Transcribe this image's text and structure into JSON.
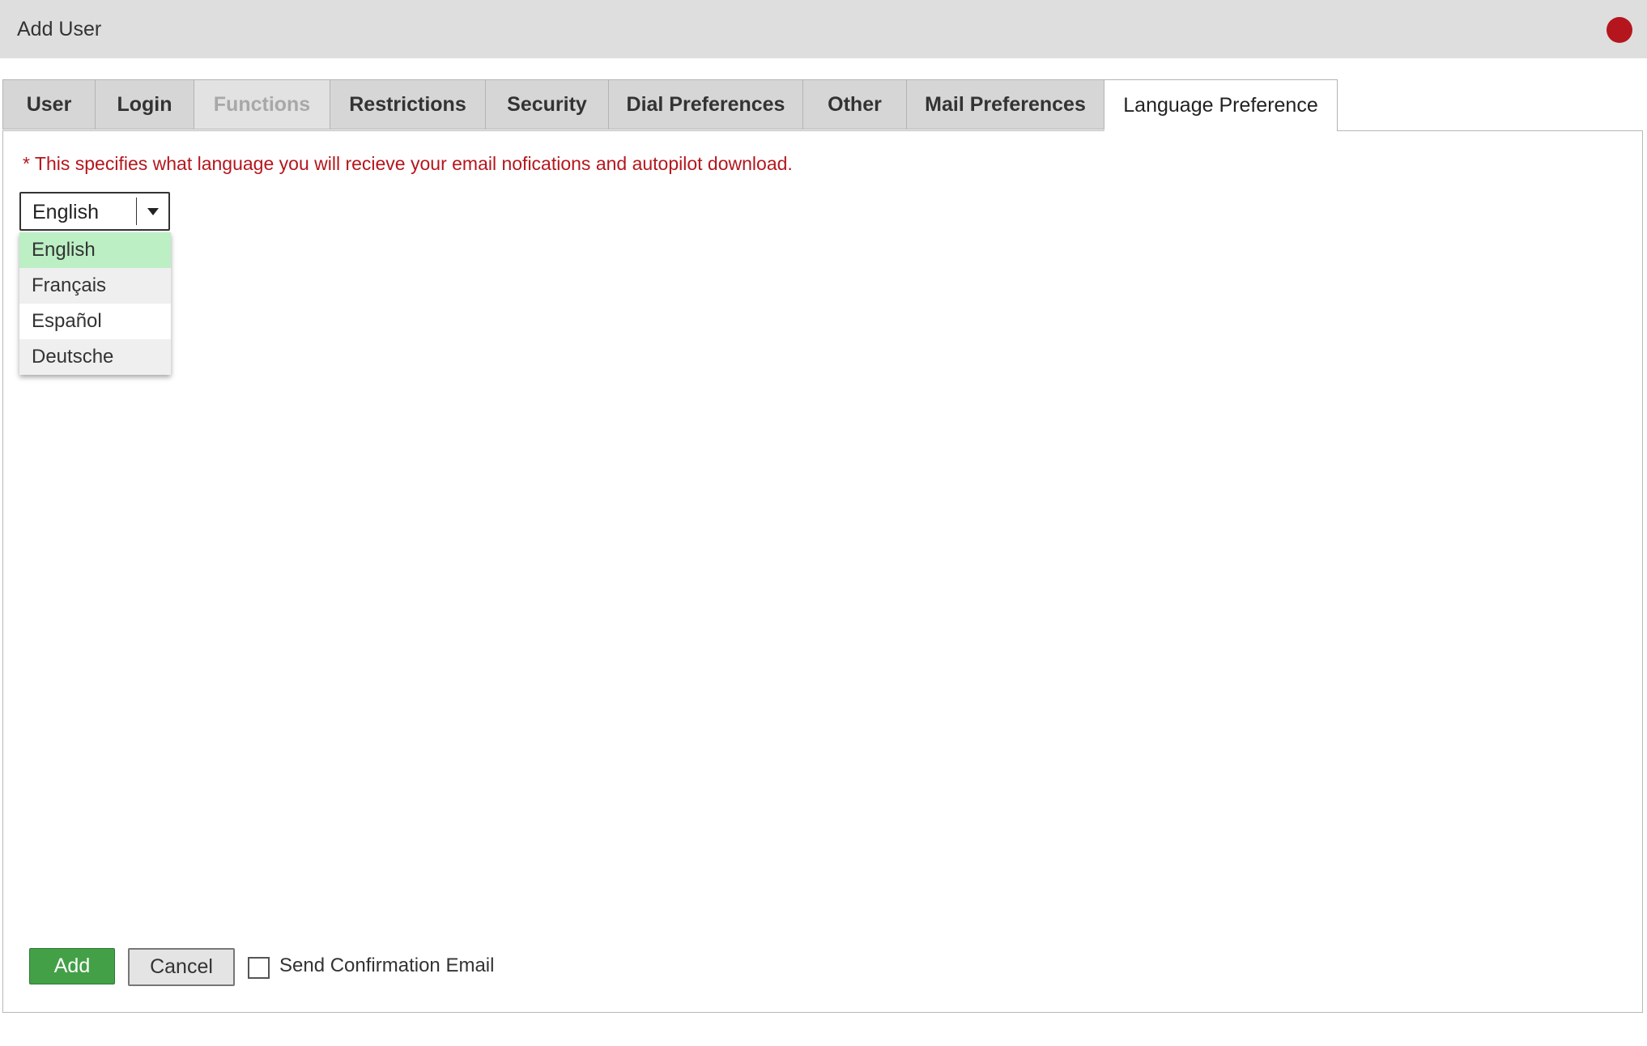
{
  "window": {
    "title": "Add User",
    "close_color": "#b5161d"
  },
  "tabs": [
    {
      "label": "User",
      "state": "normal"
    },
    {
      "label": "Login",
      "state": "normal"
    },
    {
      "label": "Functions",
      "state": "disabled"
    },
    {
      "label": "Restrictions",
      "state": "normal"
    },
    {
      "label": "Security",
      "state": "normal"
    },
    {
      "label": "Dial Preferences",
      "state": "normal"
    },
    {
      "label": "Other",
      "state": "normal"
    },
    {
      "label": "Mail Preferences",
      "state": "normal"
    },
    {
      "label": "Language Preference",
      "state": "active"
    }
  ],
  "language_panel": {
    "notice": "* This specifies what language you will recieve your email nofications and autopilot download.",
    "select": {
      "value": "English",
      "options": [
        "English",
        "Français",
        "Español",
        "Deutsche"
      ],
      "selected_index": 0
    }
  },
  "footer": {
    "add_label": "Add",
    "cancel_label": "Cancel",
    "confirmation_label": "Send Confirmation Email",
    "confirmation_checked": false
  },
  "colors": {
    "accent_red": "#b5161d",
    "add_green": "#43a047",
    "option_selected": "#bcefc4"
  }
}
